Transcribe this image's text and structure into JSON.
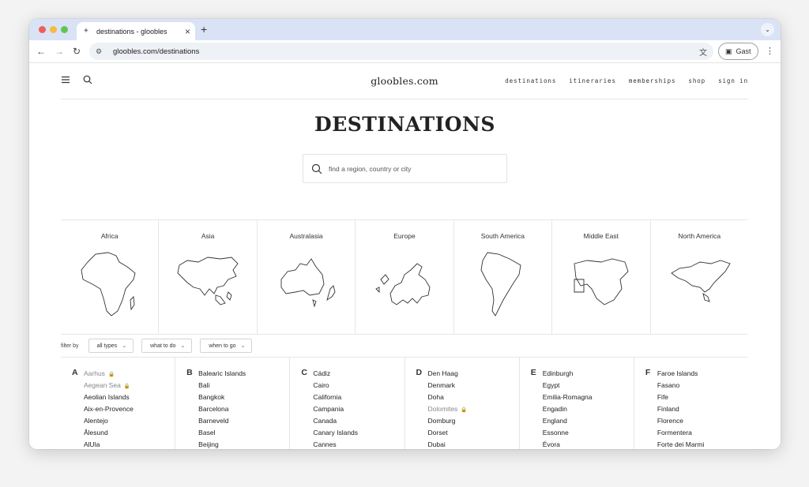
{
  "browser": {
    "tab_title": "destinations - gloobles",
    "new_tab": "+",
    "url": "gloobles.com/destinations",
    "profile_label": "Gast"
  },
  "header": {
    "logo": "gloobles.com",
    "nav": [
      "destinations",
      "itineraries",
      "memberships",
      "shop",
      "sign in"
    ]
  },
  "main": {
    "title": "DESTINATIONS",
    "search_placeholder": "find a region, country or city"
  },
  "regions": [
    {
      "name": "Africa",
      "icon": "africa-map-icon"
    },
    {
      "name": "Asia",
      "icon": "asia-map-icon"
    },
    {
      "name": "Australasia",
      "icon": "australasia-map-icon"
    },
    {
      "name": "Europe",
      "icon": "europe-map-icon"
    },
    {
      "name": "South America",
      "icon": "south-america-map-icon"
    },
    {
      "name": "Middle East",
      "icon": "middle-east-map-icon"
    },
    {
      "name": "North America",
      "icon": "north-america-map-icon"
    }
  ],
  "filters": {
    "label": "filter by",
    "items": [
      "all types",
      "what to do",
      "when to go"
    ]
  },
  "alphabet": [
    {
      "letter": "A",
      "items": [
        {
          "name": "Aarhus",
          "locked": true
        },
        {
          "name": "Aegean Sea",
          "locked": true
        },
        {
          "name": "Aeolian Islands",
          "locked": false
        },
        {
          "name": "Aix-en-Provence",
          "locked": false
        },
        {
          "name": "Alentejo",
          "locked": false
        },
        {
          "name": "Ålesund",
          "locked": false
        },
        {
          "name": "AlUla",
          "locked": false
        }
      ]
    },
    {
      "letter": "B",
      "items": [
        {
          "name": "Balearic Islands",
          "locked": false
        },
        {
          "name": "Bali",
          "locked": false
        },
        {
          "name": "Bangkok",
          "locked": false
        },
        {
          "name": "Barcelona",
          "locked": false
        },
        {
          "name": "Barneveld",
          "locked": false
        },
        {
          "name": "Basel",
          "locked": false
        },
        {
          "name": "Beijing",
          "locked": false
        }
      ]
    },
    {
      "letter": "C",
      "items": [
        {
          "name": "Cádiz",
          "locked": false
        },
        {
          "name": "Cairo",
          "locked": false
        },
        {
          "name": "California",
          "locked": false
        },
        {
          "name": "Campania",
          "locked": false
        },
        {
          "name": "Canada",
          "locked": false
        },
        {
          "name": "Canary Islands",
          "locked": false
        },
        {
          "name": "Cannes",
          "locked": false
        }
      ]
    },
    {
      "letter": "D",
      "items": [
        {
          "name": "Den Haag",
          "locked": false
        },
        {
          "name": "Denmark",
          "locked": false
        },
        {
          "name": "Doha",
          "locked": false
        },
        {
          "name": "Dolomites",
          "locked": true
        },
        {
          "name": "Domburg",
          "locked": false
        },
        {
          "name": "Dorset",
          "locked": false
        },
        {
          "name": "Dubai",
          "locked": false
        }
      ]
    },
    {
      "letter": "E",
      "items": [
        {
          "name": "Edinburgh",
          "locked": false
        },
        {
          "name": "Egypt",
          "locked": false
        },
        {
          "name": "Emilia-Romagna",
          "locked": false
        },
        {
          "name": "Engadin",
          "locked": false
        },
        {
          "name": "England",
          "locked": false
        },
        {
          "name": "Essonne",
          "locked": false
        },
        {
          "name": "Évora",
          "locked": false
        }
      ]
    },
    {
      "letter": "F",
      "items": [
        {
          "name": "Faroe Islands",
          "locked": false
        },
        {
          "name": "Fasano",
          "locked": false
        },
        {
          "name": "Fife",
          "locked": false
        },
        {
          "name": "Finland",
          "locked": false
        },
        {
          "name": "Florence",
          "locked": false
        },
        {
          "name": "Formentera",
          "locked": false
        },
        {
          "name": "Forte dei Marmi",
          "locked": false
        }
      ]
    }
  ]
}
